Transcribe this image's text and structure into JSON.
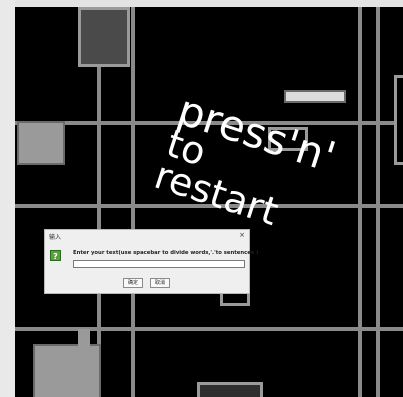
{
  "overlay": {
    "line1": "press'n'",
    "line2": "to",
    "line3": "restart"
  },
  "dialog": {
    "title": "输入",
    "close": "×",
    "icon": "question-icon",
    "icon_glyph": "?",
    "prompt": "Enter your text(use spacebar to divide words,'.'to sentences )",
    "input_value": "",
    "ok_label": "确定",
    "cancel_label": "取消"
  },
  "colors": {
    "canvas": "#000000",
    "lines": "#8a8a8a",
    "block_fill": "#9a9a9a",
    "block_dark": "#4a4a4a",
    "text": "#ffffff"
  }
}
